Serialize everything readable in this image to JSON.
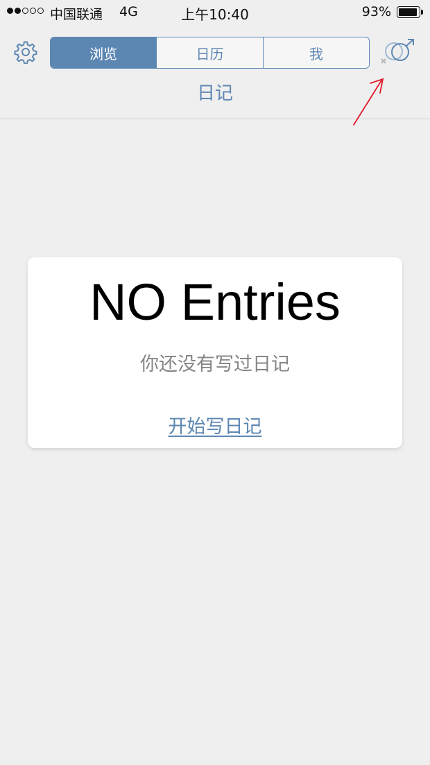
{
  "status_bar": {
    "carrier": "中国联通",
    "network": "4G",
    "time": "上午10:40",
    "battery_percent": "93%",
    "battery_level": 0.93
  },
  "nav": {
    "segments": [
      {
        "label": "浏览",
        "active": true
      },
      {
        "label": "日历",
        "active": false
      },
      {
        "label": "我",
        "active": false
      }
    ],
    "title": "日记",
    "icons": {
      "left": "gear-icon",
      "right": "gender-symbol-icon"
    }
  },
  "empty_state": {
    "title": "NO Entries",
    "subtitle": "你还没有写过日记",
    "action_label": "开始写日记"
  },
  "colors": {
    "accent": "#5d87b3",
    "background": "#efefef",
    "annotation": "#e0192b"
  }
}
